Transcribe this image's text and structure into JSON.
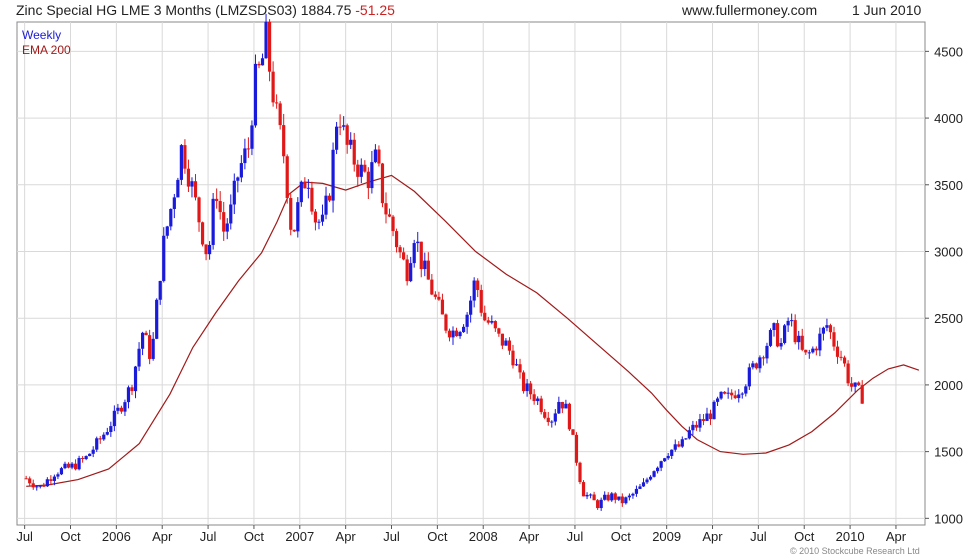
{
  "header": {
    "title_prefix": "Zinc Special HG LME 3 Months (LMZSDS03) 1884.75 ",
    "title_change": "-51.25",
    "website": "www.fullermoney.com",
    "date": "1 Jun 2010"
  },
  "legend": {
    "series1": "Weekly",
    "series2": "EMA 200"
  },
  "copyright": "© 2010 Stockcube Research Ltd",
  "colors": {
    "up": "#1a1adb",
    "down": "#e01818",
    "ema": "#a11a1a",
    "grid": "#d9d9d9",
    "axis": "#555555"
  },
  "chart_data": {
    "type": "line",
    "ylim": [
      950,
      4720
    ],
    "y_ticks": [
      1000,
      1500,
      2000,
      2500,
      3000,
      3500,
      4000,
      4500
    ],
    "x_tick_labels": [
      "Jul",
      "Oct",
      "2006",
      "Apr",
      "Jul",
      "Oct",
      "2007",
      "Apr",
      "Jul",
      "Oct",
      "2008",
      "Apr",
      "Jul",
      "Oct",
      "2009",
      "Apr",
      "Jul",
      "Oct",
      "2010",
      "Apr"
    ],
    "x_tick_months": [
      6.5,
      9.5,
      12.5,
      15.5,
      18.5,
      21.5,
      24.5,
      27.5,
      30.5,
      33.5,
      36.5,
      39.5,
      42.5,
      45.5,
      48.5,
      51.5,
      54.5,
      57.5,
      60.5,
      63.5
    ],
    "x_range_months": [
      6.0,
      65.4
    ],
    "grid": true,
    "series": [
      {
        "name": "Weekly",
        "style": "candlestick",
        "x_months": [
          6.6,
          7.5,
          8.5,
          9.5,
          10.5,
          11.5,
          12.5,
          13.5,
          14.2,
          14.8,
          15.5,
          16.2,
          16.8,
          17.5,
          18.0,
          18.5,
          19.0,
          19.5,
          20.0,
          20.5,
          21.2,
          21.5,
          22.0,
          22.3,
          22.6,
          23.0,
          23.5,
          24.0,
          24.5,
          25.0,
          25.5,
          26.0,
          26.5,
          27.0,
          27.5,
          28.0,
          28.5,
          29.0,
          29.5,
          30.0,
          30.5,
          31.0,
          31.5,
          32.0,
          32.5,
          33.0,
          33.5,
          34.0,
          34.5,
          35.0,
          35.5,
          36.0,
          36.5,
          37.0,
          37.5,
          38.0,
          38.5,
          39.0,
          39.5,
          40.0,
          40.5,
          41.0,
          41.5,
          42.0,
          42.5,
          43.0,
          43.5,
          44.0,
          44.5,
          45.0,
          45.5,
          46.0,
          46.5,
          47.0,
          47.5,
          48.0,
          48.5,
          49.0,
          49.5,
          50.0,
          50.5,
          51.0,
          51.5,
          52.0,
          52.5,
          53.0,
          53.5,
          54.0,
          54.5,
          55.0,
          55.5,
          56.0,
          56.5,
          57.0,
          57.5,
          58.0,
          58.5,
          59.0,
          59.5,
          60.0,
          60.5,
          61.0,
          61.5,
          62.0,
          62.5,
          63.0,
          63.5,
          64.0,
          64.5,
          65.0
        ],
        "values": [
          1300,
          1230,
          1350,
          1380,
          1450,
          1600,
          1780,
          2000,
          2400,
          2200,
          3000,
          3400,
          3800,
          3450,
          3200,
          2950,
          3500,
          3150,
          3300,
          3600,
          3800,
          4250,
          4400,
          4600,
          4300,
          4000,
          3700,
          3100,
          3400,
          3600,
          3250,
          3200,
          3500,
          4100,
          3800,
          3700,
          3600,
          3550,
          3700,
          3350,
          3200,
          3000,
          2850,
          3150,
          2900,
          2750,
          2600,
          2450,
          2400,
          2450,
          2550,
          2800,
          2500,
          2450,
          2350,
          2300,
          2200,
          2000,
          1950,
          1900,
          1800,
          1750,
          1900,
          1800,
          1500,
          1200,
          1150,
          1100,
          1150,
          1170,
          1120,
          1150,
          1200,
          1250,
          1350,
          1420,
          1500,
          1520,
          1550,
          1650,
          1700,
          1750,
          1800,
          1900,
          1900,
          1950,
          2000,
          2100,
          2200,
          2300,
          2400,
          2300,
          2500,
          2350,
          2200,
          2250,
          2350,
          2450,
          2300,
          2200,
          2000,
          1950,
          1890
        ],
        "up": "#1a1adb",
        "down": "#e01818"
      },
      {
        "name": "EMA 200",
        "style": "line",
        "x_months": [
          6.6,
          8.0,
          10.0,
          12.0,
          14.0,
          16.0,
          17.5,
          19.0,
          20.5,
          22.0,
          23.0,
          23.8,
          24.8,
          26.0,
          27.5,
          29.0,
          30.5,
          32.0,
          34.0,
          36.0,
          38.0,
          40.0,
          42.0,
          44.0,
          46.0,
          47.5,
          48.5,
          49.5,
          50.5,
          52.0,
          53.5,
          55.0,
          56.5,
          58.0,
          59.5,
          61.0,
          62.0,
          63.0,
          64.0,
          65.0
        ],
        "values": [
          1240,
          1250,
          1290,
          1370,
          1560,
          1930,
          2280,
          2540,
          2780,
          2990,
          3220,
          3430,
          3520,
          3510,
          3460,
          3520,
          3570,
          3450,
          3230,
          3000,
          2830,
          2690,
          2500,
          2300,
          2100,
          1940,
          1810,
          1690,
          1590,
          1500,
          1480,
          1490,
          1550,
          1650,
          1790,
          1960,
          2050,
          2120,
          2150,
          2110
        ],
        "color": "#a11a1a"
      }
    ]
  }
}
